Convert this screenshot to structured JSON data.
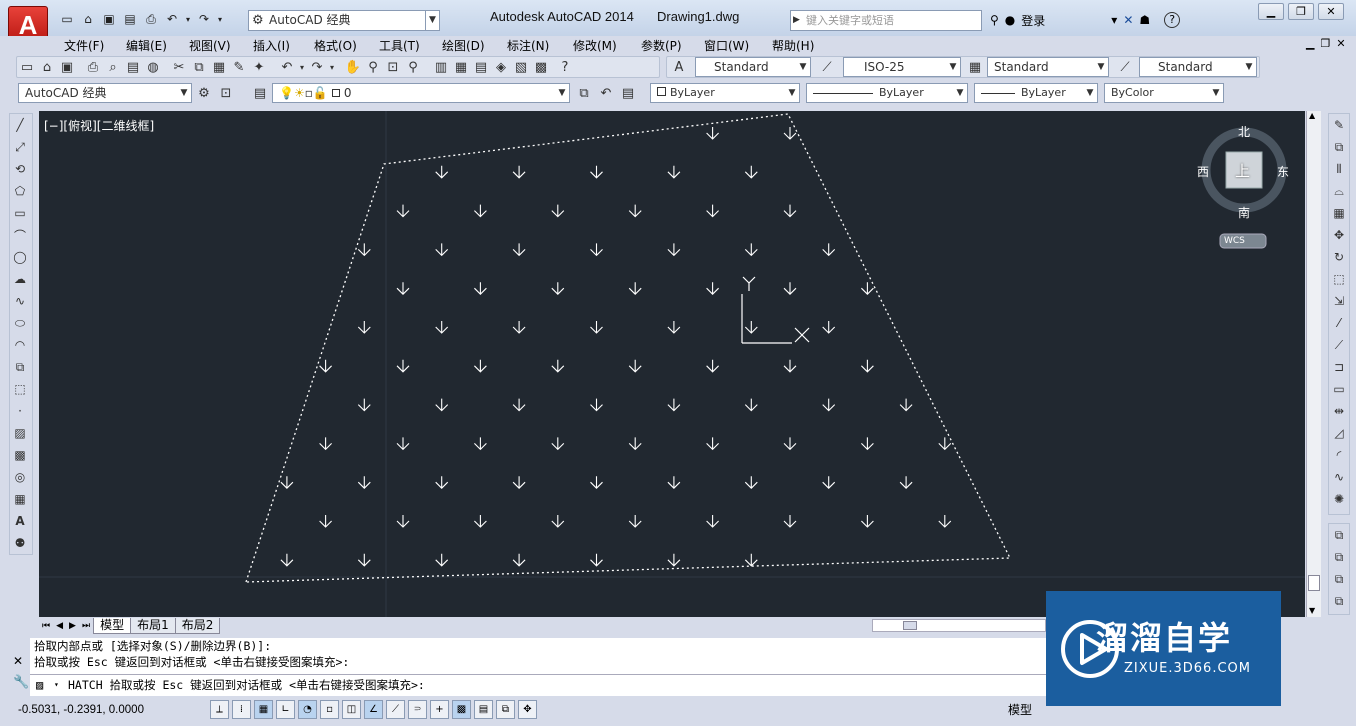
{
  "title_bar": {
    "app_title": "Autodesk AutoCAD 2014",
    "doc_title": "Drawing1.dwg",
    "workspace": "AutoCAD 经典",
    "search_placeholder": "键入关键字或短语",
    "login": "登录"
  },
  "menu": [
    "文件(F)",
    "编辑(E)",
    "视图(V)",
    "插入(I)",
    "格式(O)",
    "工具(T)",
    "绘图(D)",
    "标注(N)",
    "修改(M)",
    "参数(P)",
    "窗口(W)",
    "帮助(H)"
  ],
  "styles": {
    "text_style": "Standard",
    "dim_style": "ISO-25",
    "table_style": "Standard",
    "mleader_style": "Standard"
  },
  "layers": {
    "workspace": "AutoCAD 经典",
    "layer": "0",
    "color": "ByLayer",
    "linetype": "ByLayer",
    "lineweight": "ByLayer",
    "plotstyle": "ByColor"
  },
  "viewport": {
    "label": "[−][俯视][二维线框]",
    "ucs_y": "Y",
    "ucs_x": "X"
  },
  "viewcube": {
    "north": "北",
    "south": "南",
    "east": "东",
    "west": "西",
    "top": "上",
    "wcs": "WCS"
  },
  "layout_tabs": [
    "模型",
    "布局1",
    "布局2"
  ],
  "command": {
    "line1": "拾取内部点或 [选择对象(S)/删除边界(B)]:",
    "line2": "拾取或按 Esc 键返回到对话框或 <单击右键接受图案填充>:",
    "prompt": "HATCH 拾取或按 Esc 键返回到对话框或 <单击右键接受图案填充>:"
  },
  "status": {
    "coords": "-0.5031, -0.2391, 0.0000",
    "model": "模型"
  },
  "watermark": {
    "brand": "溜溜自学",
    "url": "ZIXUE.3D66.COM"
  },
  "colors": {
    "viewport_bg": "#212830",
    "ui_bg": "#d6dbe9",
    "accent": "#1b5e9f"
  }
}
